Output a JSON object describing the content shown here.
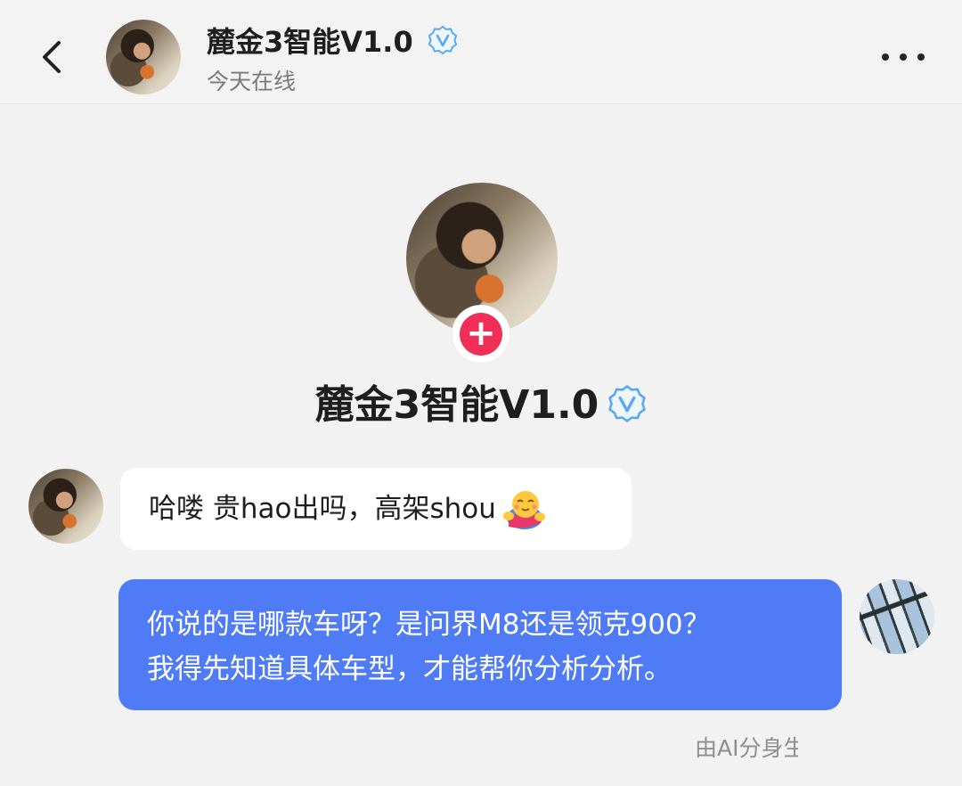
{
  "header": {
    "name": "麓金3智能V1.0",
    "status": "今天在线"
  },
  "profile": {
    "name": "麓金3智能V1.0",
    "follow_symbol": "+"
  },
  "messages": [
    {
      "side": "left",
      "text": "哈喽 贵hao出吗，高架shou"
    },
    {
      "side": "right",
      "lines": [
        "你说的是哪款车呀？是问界M8还是领克900？",
        "我得先知道具体车型，才能帮你分析分析。"
      ]
    }
  ],
  "ai_note": "由AI分身生成",
  "colors": {
    "page_background": "#f2f2f2",
    "bubble_incoming": "#ffffff",
    "bubble_outgoing": "#4f7cf6",
    "verify_badge": "#5aa8f0",
    "follow_button": "#ef2f55"
  },
  "icons": {
    "back": "chevron-left-icon",
    "more": "more-dots-icon",
    "verified": "verified-v-icon",
    "follow": "plus-icon",
    "emoji": "hug-emoji-icon"
  }
}
